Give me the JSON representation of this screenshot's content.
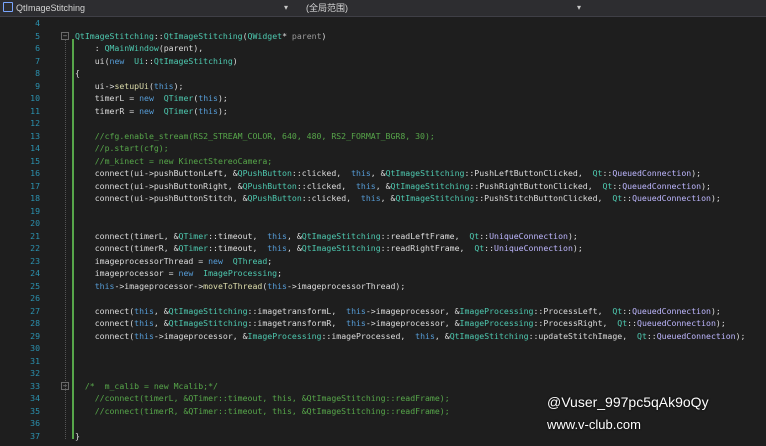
{
  "toolbar": {
    "file_dropdown": "QtImageStitching",
    "scope_dropdown": "(全局范围)"
  },
  "editor": {
    "line_numbers": [
      "4",
      "5",
      "6",
      "7",
      "8",
      "9",
      "10",
      "11",
      "12",
      "13",
      "14",
      "15",
      "16",
      "17",
      "18",
      "19",
      "20",
      "21",
      "22",
      "23",
      "24",
      "25",
      "26",
      "27",
      "28",
      "29",
      "30",
      "31",
      "32",
      "33",
      "34",
      "35",
      "36",
      "37"
    ],
    "lines": [
      [],
      [
        [
          "ty",
          "QtImageStitching"
        ],
        [
          "",
          "::"
        ],
        [
          "ty",
          "QtImageStitching"
        ],
        [
          "",
          "("
        ],
        [
          "ty",
          "QWidget"
        ],
        [
          "",
          "* "
        ],
        [
          "pm",
          "parent"
        ],
        [
          "",
          ")"
        ]
      ],
      [
        [
          "",
          "    : "
        ],
        [
          "ty",
          "QMainWindow"
        ],
        [
          "",
          "(parent),"
        ]
      ],
      [
        [
          "",
          "    ui("
        ],
        [
          "kw",
          "new"
        ],
        [
          "",
          "  "
        ],
        [
          "ty",
          "Ui"
        ],
        [
          "",
          "::"
        ],
        [
          "ty",
          "QtImageStitching"
        ],
        [
          "",
          ")"
        ]
      ],
      [
        [
          "",
          "{"
        ]
      ],
      [
        [
          "",
          "    ui->"
        ],
        [
          "fn",
          "setupUi"
        ],
        [
          "",
          "("
        ],
        [
          "kw",
          "this"
        ],
        [
          "",
          ");"
        ]
      ],
      [
        [
          "",
          "    timerL = "
        ],
        [
          "kw",
          "new"
        ],
        [
          "",
          "  "
        ],
        [
          "ty",
          "QTimer"
        ],
        [
          "",
          "("
        ],
        [
          "kw",
          "this"
        ],
        [
          "",
          ");"
        ]
      ],
      [
        [
          "",
          "    timerR = "
        ],
        [
          "kw",
          "new"
        ],
        [
          "",
          "  "
        ],
        [
          "ty",
          "QTimer"
        ],
        [
          "",
          "("
        ],
        [
          "kw",
          "this"
        ],
        [
          "",
          ");"
        ]
      ],
      [],
      [
        [
          "cm",
          "    //cfg.enable_stream(RS2_STREAM_COLOR, 640, 480, RS2_FORMAT_BGR8, 30);"
        ]
      ],
      [
        [
          "cm",
          "    //p.start(cfg);"
        ]
      ],
      [
        [
          "cm",
          "    //m_kinect = new KinectStereoCamera;"
        ]
      ],
      [
        [
          "",
          "    connect(ui->pushButtonLeft, &"
        ],
        [
          "ty",
          "QPushButton"
        ],
        [
          "",
          "::clicked,  "
        ],
        [
          "kw",
          "this"
        ],
        [
          "",
          ", &"
        ],
        [
          "ty",
          "QtImageStitching"
        ],
        [
          "",
          "::PushLeftButtonClicked,  "
        ],
        [
          "ty",
          "Qt"
        ],
        [
          "",
          "::"
        ],
        [
          "mc",
          "QueuedConnection"
        ],
        [
          "",
          ");"
        ]
      ],
      [
        [
          "",
          "    connect(ui->pushButtonRight, &"
        ],
        [
          "ty",
          "QPushButton"
        ],
        [
          "",
          "::clicked,  "
        ],
        [
          "kw",
          "this"
        ],
        [
          "",
          ", &"
        ],
        [
          "ty",
          "QtImageStitching"
        ],
        [
          "",
          "::PushRightButtonClicked,  "
        ],
        [
          "ty",
          "Qt"
        ],
        [
          "",
          "::"
        ],
        [
          "mc",
          "QueuedConnection"
        ],
        [
          "",
          ");"
        ]
      ],
      [
        [
          "",
          "    connect(ui->pushButtonStitch, &"
        ],
        [
          "ty",
          "QPushButton"
        ],
        [
          "",
          "::clicked,  "
        ],
        [
          "kw",
          "this"
        ],
        [
          "",
          ", &"
        ],
        [
          "ty",
          "QtImageStitching"
        ],
        [
          "",
          "::PushStitchButtonClicked,  "
        ],
        [
          "ty",
          "Qt"
        ],
        [
          "",
          "::"
        ],
        [
          "mc",
          "QueuedConnection"
        ],
        [
          "",
          ");"
        ]
      ],
      [],
      [],
      [
        [
          "",
          "    connect(timerL, &"
        ],
        [
          "ty",
          "QTimer"
        ],
        [
          "",
          "::timeout,  "
        ],
        [
          "kw",
          "this"
        ],
        [
          "",
          ", &"
        ],
        [
          "ty",
          "QtImageStitching"
        ],
        [
          "",
          "::readLeftFrame,  "
        ],
        [
          "ty",
          "Qt"
        ],
        [
          "",
          "::"
        ],
        [
          "mc",
          "UniqueConnection"
        ],
        [
          "",
          ");"
        ]
      ],
      [
        [
          "",
          "    connect(timerR, &"
        ],
        [
          "ty",
          "QTimer"
        ],
        [
          "",
          "::timeout,  "
        ],
        [
          "kw",
          "this"
        ],
        [
          "",
          ", &"
        ],
        [
          "ty",
          "QtImageStitching"
        ],
        [
          "",
          "::readRightFrame,  "
        ],
        [
          "ty",
          "Qt"
        ],
        [
          "",
          "::"
        ],
        [
          "mc",
          "UniqueConnection"
        ],
        [
          "",
          ");"
        ]
      ],
      [
        [
          "",
          "    imageprocessorThread = "
        ],
        [
          "kw",
          "new"
        ],
        [
          "",
          "  "
        ],
        [
          "ty",
          "QThread"
        ],
        [
          "",
          ";"
        ]
      ],
      [
        [
          "",
          "    imageprocessor = "
        ],
        [
          "kw",
          "new"
        ],
        [
          "",
          "  "
        ],
        [
          "ty",
          "ImageProcessing"
        ],
        [
          "",
          ";"
        ]
      ],
      [
        [
          "",
          "    "
        ],
        [
          "kw",
          "this"
        ],
        [
          "",
          "->imageprocessor->"
        ],
        [
          "fn",
          "moveToThread"
        ],
        [
          "",
          "("
        ],
        [
          "kw",
          "this"
        ],
        [
          "",
          "->imageprocessorThread);"
        ]
      ],
      [],
      [
        [
          "",
          "    connect("
        ],
        [
          "kw",
          "this"
        ],
        [
          "",
          ", &"
        ],
        [
          "ty",
          "QtImageStitching"
        ],
        [
          "",
          "::imagetransformL,  "
        ],
        [
          "kw",
          "this"
        ],
        [
          "",
          "->imageprocessor, &"
        ],
        [
          "ty",
          "ImageProcessing"
        ],
        [
          "",
          "::ProcessLeft,  "
        ],
        [
          "ty",
          "Qt"
        ],
        [
          "",
          "::"
        ],
        [
          "mc",
          "QueuedConnection"
        ],
        [
          "",
          ");"
        ]
      ],
      [
        [
          "",
          "    connect("
        ],
        [
          "kw",
          "this"
        ],
        [
          "",
          ", &"
        ],
        [
          "ty",
          "QtImageStitching"
        ],
        [
          "",
          "::imagetransformR,  "
        ],
        [
          "kw",
          "this"
        ],
        [
          "",
          "->imageprocessor, &"
        ],
        [
          "ty",
          "ImageProcessing"
        ],
        [
          "",
          "::ProcessRight,  "
        ],
        [
          "ty",
          "Qt"
        ],
        [
          "",
          "::"
        ],
        [
          "mc",
          "QueuedConnection"
        ],
        [
          "",
          ");"
        ]
      ],
      [
        [
          "",
          "    connect("
        ],
        [
          "kw",
          "this"
        ],
        [
          "",
          "->imageprocessor, &"
        ],
        [
          "ty",
          "ImageProcessing"
        ],
        [
          "",
          "::imageProcessed,  "
        ],
        [
          "kw",
          "this"
        ],
        [
          "",
          ", &"
        ],
        [
          "ty",
          "QtImageStitching"
        ],
        [
          "",
          "::updateStitchImage,  "
        ],
        [
          "ty",
          "Qt"
        ],
        [
          "",
          "::"
        ],
        [
          "mc",
          "QueuedConnection"
        ],
        [
          "",
          ");"
        ]
      ],
      [],
      [],
      [],
      [
        [
          "cm",
          "  /*  m_calib = new Mcalib;*/"
        ]
      ],
      [
        [
          "cm",
          "    //connect(timerL, &QTimer::timeout, this, &QtImageStitching::readFrame);"
        ]
      ],
      [
        [
          "cm",
          "    //connect(timerR, &QTimer::timeout, this, &QtImageStitching::readFrame);"
        ]
      ],
      [],
      [
        [
          "",
          "}"
        ]
      ]
    ]
  },
  "watermark": {
    "user": "@Vuser_997pc5qAk9oQy",
    "site": "www.v-club.com"
  }
}
